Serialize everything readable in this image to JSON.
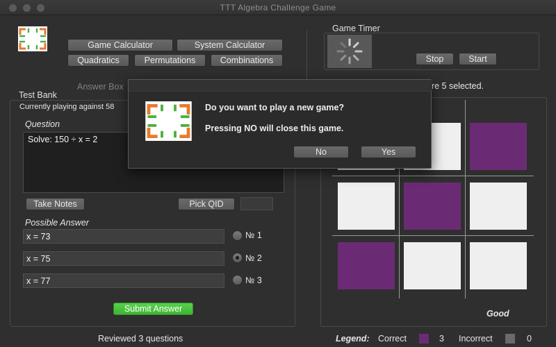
{
  "window": {
    "title": "TTT Algebra Challenge Game"
  },
  "toolbar": {
    "game_calculator": "Game Calculator",
    "system_calculator": "System Calculator",
    "quadratics": "Quadratics",
    "permutations": "Permutations",
    "combinations": "Combinations"
  },
  "timer": {
    "label": "Game Timer",
    "stop": "Stop",
    "start": "Start"
  },
  "answer_box": {
    "label": "Answer Box",
    "status_fragment": "are 5 selected."
  },
  "test_bank": {
    "label": "Test Bank",
    "playing_text": "Currently playing against 58",
    "question_label": "Question",
    "question_text": "Solve: 150 ÷ x = 2",
    "take_notes": "Take Notes",
    "pick_qid": "Pick QID",
    "qid_value": "",
    "possible_answer_label": "Possible Answer",
    "answers": [
      {
        "value": "x = 73",
        "label": "№ 1",
        "selected": false
      },
      {
        "value": "x = 75",
        "label": "№ 2",
        "selected": true
      },
      {
        "value": "x = 77",
        "label": "№ 3",
        "selected": false
      }
    ],
    "submit": "Submit Answer",
    "reviewed": "Reviewed 3 questions"
  },
  "board": {
    "cells": [
      "white",
      "white",
      "purple",
      "white",
      "purple",
      "white",
      "purple",
      "white",
      "white"
    ],
    "status": "Good"
  },
  "legend": {
    "label": "Legend:",
    "correct_label": "Correct",
    "correct_count": "3",
    "incorrect_label": "Incorrect",
    "incorrect_count": "0",
    "correct_color": "#6b2b74",
    "incorrect_color": "#6a6a6a"
  },
  "dialog": {
    "line1": "Do you want to play a new game?",
    "line2": "Pressing NO will close this game.",
    "no": "No",
    "yes": "Yes"
  },
  "colors": {
    "logo_orange": "#e87a2c",
    "logo_green": "#4cae3c",
    "accent_purple": "#6b2b74",
    "submit_green": "#4cc43f"
  }
}
